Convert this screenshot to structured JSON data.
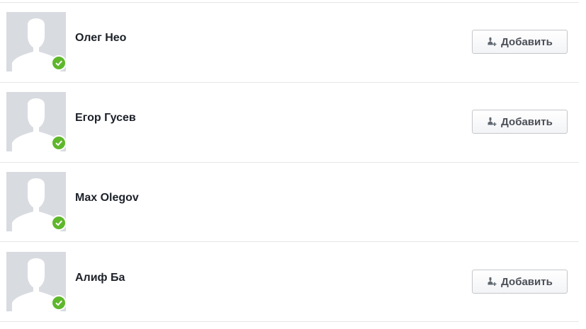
{
  "friends": [
    {
      "name": "Олег Нео",
      "online": true,
      "action_label": "Добавить",
      "action_icon": "add-friend-icon"
    },
    {
      "name": "Егор Гусев",
      "online": true,
      "action_label": "Добавить",
      "action_icon": "add-friend-icon"
    },
    {
      "name": "Max Olegov",
      "online": true,
      "action_label": null,
      "action_icon": null
    },
    {
      "name": "Алиф Ба",
      "online": true,
      "action_label": "Добавить",
      "action_icon": "add-friend-icon"
    }
  ],
  "colors": {
    "online": "#5fb72b",
    "divider": "#e5e6e9",
    "avatar_bg": "#d8dbe0",
    "name_text": "#1d2129",
    "button_text": "#4b4f56"
  }
}
